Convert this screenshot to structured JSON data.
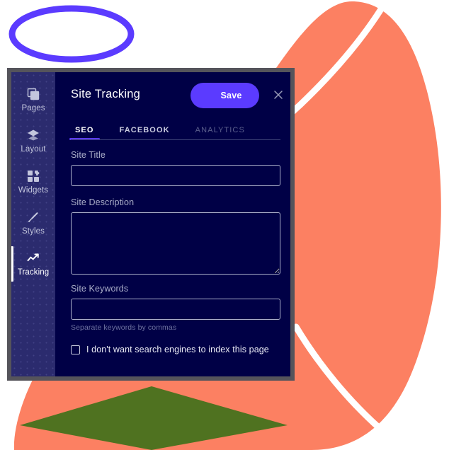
{
  "background": {
    "canvas_color": "#ffffff",
    "ellipse_outline_color": "#5b3bff",
    "blob_color": "#fc8062",
    "stripe_color": "#ffffff",
    "diamond_color": "#4f7220"
  },
  "modal": {
    "title": "Site Tracking",
    "frame_color": "#55545b",
    "body_color": "#000046",
    "save_label": "Save",
    "save_color": "#5b3bff",
    "close_icon": "close-icon"
  },
  "sidebar": {
    "background_color": "#2b2b6e",
    "items": [
      {
        "label": "Pages",
        "icon": "pages-icon",
        "active": false
      },
      {
        "label": "Layout",
        "icon": "layers-icon",
        "active": false
      },
      {
        "label": "Widgets",
        "icon": "widgets-icon",
        "active": false
      },
      {
        "label": "Styles",
        "icon": "brush-icon",
        "active": false
      },
      {
        "label": "Tracking",
        "icon": "trend-up-icon",
        "active": true
      }
    ]
  },
  "tabs": [
    {
      "label": "SEO",
      "active": true
    },
    {
      "label": "FACEBOOK",
      "active": false
    },
    {
      "label": "ANALYTICS",
      "active": false,
      "disabled": true
    }
  ],
  "form": {
    "site_title": {
      "label": "Site Title",
      "value": "",
      "placeholder": ""
    },
    "site_description": {
      "label": "Site Description",
      "value": "",
      "placeholder": ""
    },
    "site_keywords": {
      "label": "Site Keywords",
      "value": "",
      "placeholder": "",
      "hint": "Separate keywords by commas"
    },
    "noindex": {
      "label": "I don't want search engines to index this page",
      "checked": false
    }
  }
}
